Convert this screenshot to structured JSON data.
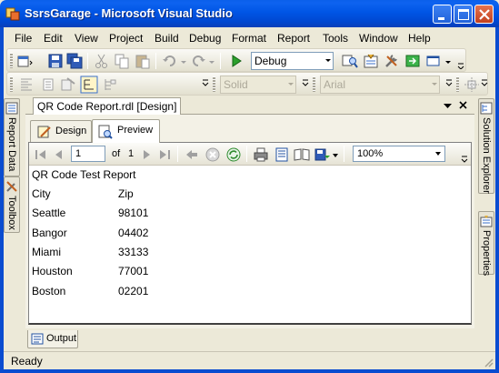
{
  "window": {
    "title": "SsrsGarage - Microsoft Visual Studio"
  },
  "menu": [
    "File",
    "Edit",
    "View",
    "Project",
    "Build",
    "Debug",
    "Format",
    "Report",
    "Tools",
    "Window",
    "Help"
  ],
  "toolbar": {
    "solution_config": "Debug",
    "border_style": "Solid",
    "font_name": "Arial"
  },
  "side_left": {
    "report_data": "Report Data",
    "toolbox": "Toolbox"
  },
  "side_right": {
    "solution_explorer": "Solution Explorer",
    "properties": "Properties"
  },
  "document": {
    "tab_title": "QR Code Report.rdl [Design]",
    "tabs": {
      "design": "Design",
      "preview": "Preview"
    }
  },
  "report_toolbar": {
    "page_current": "1",
    "page_of": "of",
    "page_total": "1",
    "zoom": "100%"
  },
  "report": {
    "title": "QR Code Test Report",
    "headers": [
      "City",
      "Zip"
    ],
    "rows": [
      [
        "Seattle",
        "98101"
      ],
      [
        "Bangor",
        "04402"
      ],
      [
        "Miami",
        "33133"
      ],
      [
        "Houston",
        "77001"
      ],
      [
        "Boston",
        "02201"
      ]
    ]
  },
  "output": {
    "label": "Output"
  },
  "status": {
    "text": "Ready"
  },
  "colors": {
    "titlebar": "#0055E5",
    "chrome": "#ECE9D8",
    "close_button": "#C2401E"
  }
}
